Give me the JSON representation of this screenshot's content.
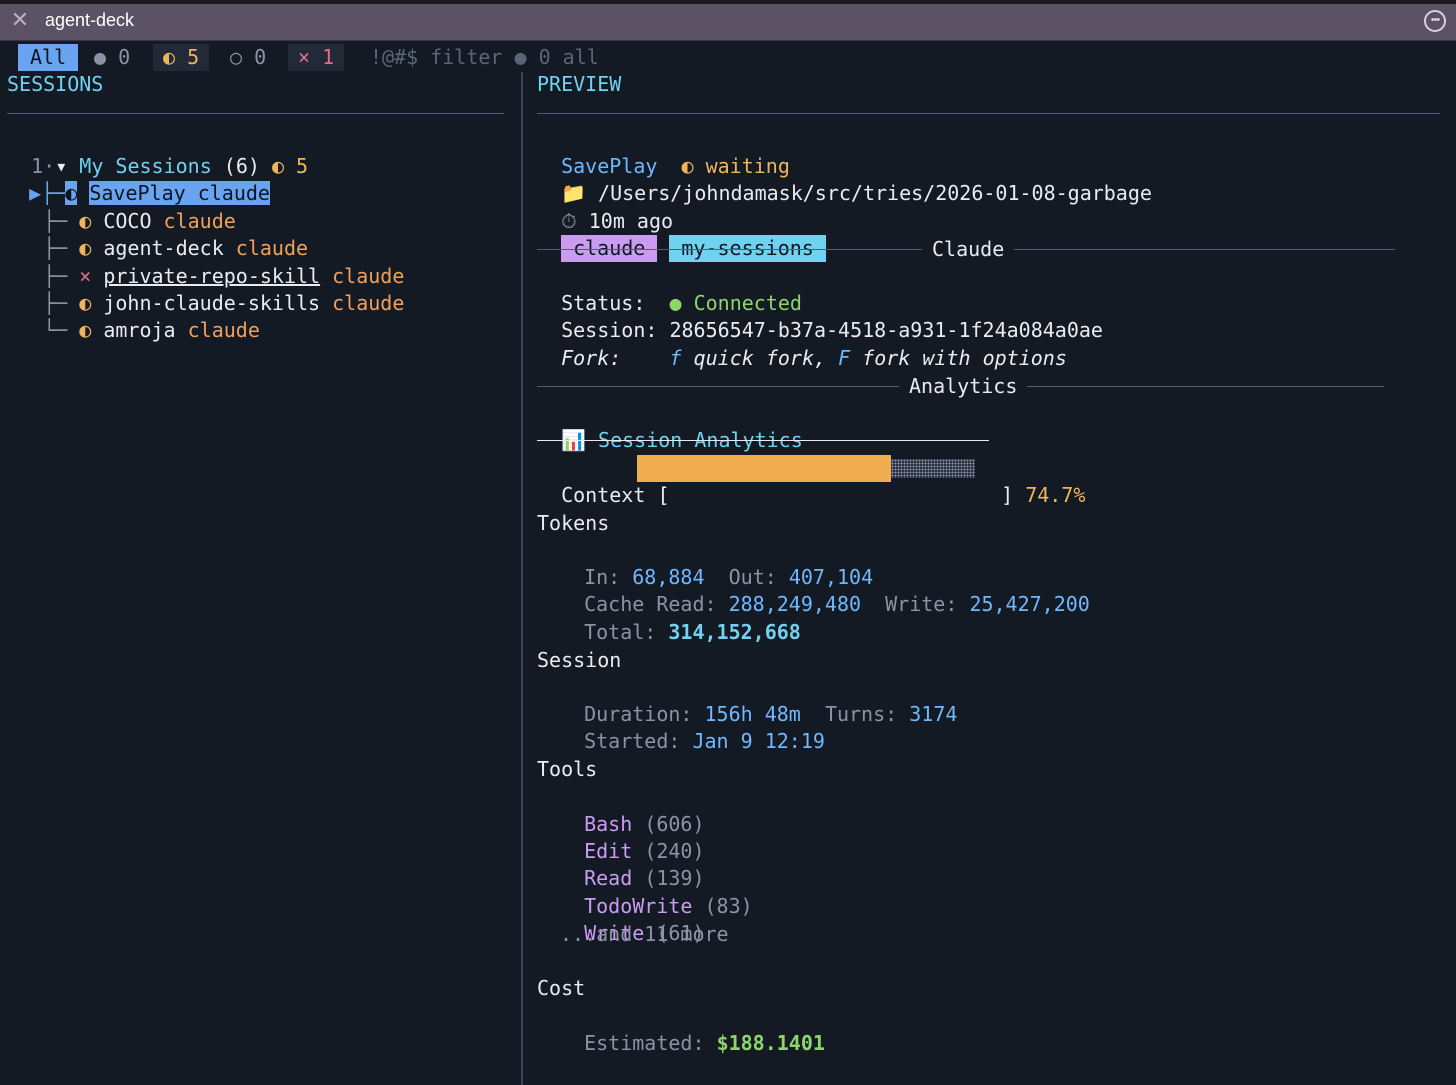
{
  "window": {
    "title": "agent-deck"
  },
  "tabs": {
    "all": "All",
    "running": "● 0",
    "waiting": "◐ 5",
    "idle": "○ 0",
    "error": "× 1",
    "filter_hint": "!@#$ filter ● 0 all"
  },
  "sessions_panel": {
    "header": "SESSIONS",
    "group": {
      "index": "1·",
      "arrow": "▾",
      "name": "My Sessions",
      "count": "(6)",
      "status": "◐ 5"
    },
    "items": [
      {
        "tree": "├─",
        "icon": "◐",
        "name": "SavePlay",
        "tool": "claude"
      },
      {
        "tree": "├─",
        "icon": "◐",
        "name": "COCO",
        "tool": "claude"
      },
      {
        "tree": "├─",
        "icon": "◐",
        "name": "agent-deck",
        "tool": "claude"
      },
      {
        "tree": "├─",
        "icon": "×",
        "name": "private-repo-skill",
        "tool": "claude"
      },
      {
        "tree": "├─",
        "icon": "◐",
        "name": "john-claude-skills",
        "tool": "claude"
      },
      {
        "tree": "└─",
        "icon": "◐",
        "name": "amroja",
        "tool": "claude"
      }
    ]
  },
  "preview": {
    "header": "PREVIEW",
    "name": "SavePlay",
    "status": "◐ waiting",
    "path_icon": "📁",
    "path": "/Users/johndamask/src/tries/2026-01-08-garbage",
    "time_icon": "⏱",
    "time": "10m ago",
    "tags": [
      "claude",
      "my-sessions"
    ],
    "claude_section": {
      "title": "Claude",
      "status_label": "Status:",
      "status_value": "● Connected",
      "session_label": "Session:",
      "session_id": "28656547-b37a-4518-a931-1f24a084a0ae",
      "fork_label": "Fork:",
      "fork_key1": "f",
      "fork_text1": "quick fork,",
      "fork_key2": "F",
      "fork_text2": "fork with options"
    },
    "analytics": {
      "section_title": "Analytics",
      "icon": "📊",
      "title": "Session Analytics",
      "context_label": "Context",
      "context_percent": "74.7%",
      "context_fraction": 0.747,
      "tokens_title": "Tokens",
      "in_label": "In:",
      "in_value": "68,884",
      "out_label": "Out:",
      "out_value": "407,104",
      "cache_read_label": "Cache Read:",
      "cache_read_value": "288,249,480",
      "write_label": "Write:",
      "write_value": "25,427,200",
      "total_label": "Total:",
      "total_value": "314,152,668",
      "session_title": "Session",
      "duration_label": "Duration:",
      "duration_value": "156h 48m",
      "turns_label": "Turns:",
      "turns_value": "3174",
      "started_label": "Started:",
      "started_value": "Jan 9 12:19",
      "tools_title": "Tools",
      "tools": [
        {
          "name": "Bash",
          "count": "(606)"
        },
        {
          "name": "Edit",
          "count": "(240)"
        },
        {
          "name": "Read",
          "count": "(139)"
        },
        {
          "name": "TodoWrite",
          "count": "(83)"
        },
        {
          "name": "Write",
          "count": "(61)"
        }
      ],
      "tools_more": "...and 11 more",
      "cost_title": "Cost",
      "estimated_label": "Estimated:",
      "estimated_value": "$188.1401"
    }
  }
}
